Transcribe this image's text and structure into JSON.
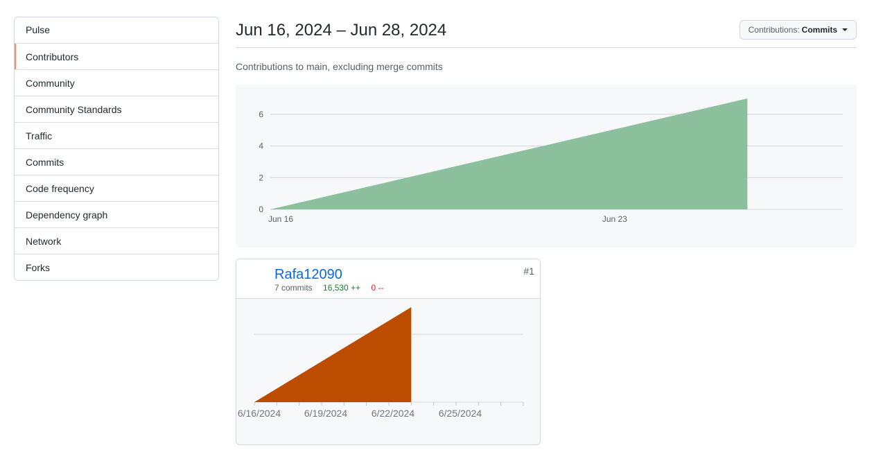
{
  "sidebar": {
    "items": [
      {
        "label": "Pulse"
      },
      {
        "label": "Contributors",
        "selected": true
      },
      {
        "label": "Community"
      },
      {
        "label": "Community Standards"
      },
      {
        "label": "Traffic"
      },
      {
        "label": "Commits"
      },
      {
        "label": "Code frequency"
      },
      {
        "label": "Dependency graph"
      },
      {
        "label": "Network"
      },
      {
        "label": "Forks"
      }
    ]
  },
  "header": {
    "title": "Jun 16, 2024 – Jun 28, 2024",
    "dropdown_prefix": "Contributions:",
    "dropdown_value": "Commits",
    "subtitle": "Contributions to main, excluding merge commits"
  },
  "colors": {
    "main_area": "#8cc09c",
    "contributor_area": "#bc4c00",
    "accent_selected": "#fd8c73",
    "link": "#0969da",
    "additions": "#1a7f37",
    "deletions": "#cf222e"
  },
  "chart_data": [
    {
      "type": "area",
      "x": [
        "Jun 16",
        "Jun 26"
      ],
      "y": [
        0,
        7
      ],
      "x_domain": [
        "Jun 16",
        "Jun 28"
      ],
      "x_ticks": [
        "Jun 16",
        "Jun 23"
      ],
      "y_ticks": [
        0,
        2,
        4,
        6
      ],
      "ylim": [
        0,
        7
      ],
      "grid": true
    },
    {
      "type": "area",
      "x": [
        "6/16/2024",
        "6/23/2024"
      ],
      "y": [
        0,
        7
      ],
      "x_domain": [
        "6/16/2024",
        "6/28/2024"
      ],
      "x_tick_labels": [
        "6/16/2024",
        "6/19/2024",
        "6/22/2024",
        "6/25/2024"
      ],
      "ylim": [
        0,
        7
      ],
      "gridline_at": 5,
      "grid": true
    }
  ],
  "contributor": {
    "name": "Rafa12090",
    "commits": "7 commits",
    "additions": "16,530 ++",
    "deletions": "0 --",
    "rank": "#1",
    "avatar_icon": "nerd-face-avatar"
  }
}
